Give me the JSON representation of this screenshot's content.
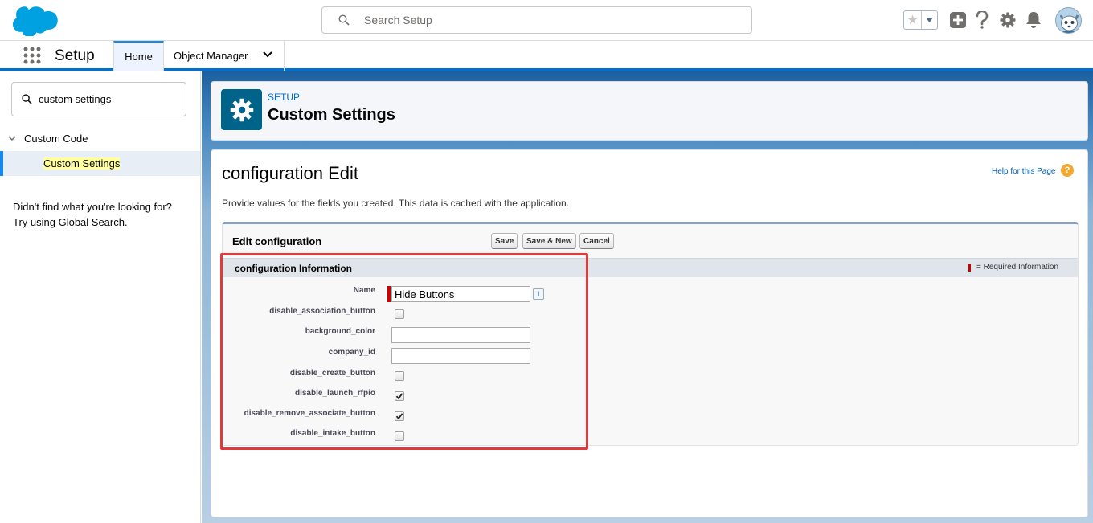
{
  "header": {
    "search_placeholder": "Search Setup",
    "icons": [
      "salesforce-cloud-logo",
      "search-icon",
      "favorites-star-icon",
      "chevron-down-icon",
      "add-icon",
      "help-icon",
      "gear-icon",
      "bell-icon",
      "avatar"
    ]
  },
  "context_bar": {
    "app_name": "Setup",
    "tabs": [
      {
        "label": "Home",
        "active": true
      },
      {
        "label": "Object Manager",
        "has_dropdown": true
      }
    ]
  },
  "sidebar": {
    "quickfind_value": "custom settings",
    "tree_parent": "Custom Code",
    "tree_child": "Custom Settings",
    "not_found_line1": "Didn't find what you're looking for?",
    "not_found_line2": "Try using Global Search."
  },
  "page_header": {
    "kicker": "SETUP",
    "title": "Custom Settings"
  },
  "main": {
    "title": "configuration Edit",
    "help_link": "Help for this Page",
    "description": "Provide values for the fields you created. This data is cached with the application.",
    "block_title": "Edit configuration",
    "buttons": {
      "save": "Save",
      "save_new": "Save & New",
      "cancel": "Cancel"
    },
    "section_title": "configuration Information",
    "required_legend": "= Required Information",
    "fields": {
      "name": {
        "label": "Name",
        "value": "Hide Buttons",
        "required": true
      },
      "disable_association_button": {
        "label": "disable_association_button",
        "checked": false
      },
      "background_color": {
        "label": "background_color",
        "value": ""
      },
      "company_id": {
        "label": "company_id",
        "value": ""
      },
      "disable_create_button": {
        "label": "disable_create_button",
        "checked": false
      },
      "disable_launch_rfpio": {
        "label": "disable_launch_rfpio",
        "checked": true
      },
      "disable_remove_associate_button": {
        "label": "disable_remove_associate_button",
        "checked": true
      },
      "disable_intake_button": {
        "label": "disable_intake_button",
        "checked": false
      }
    }
  },
  "colors": {
    "brand_blue": "#0070d2",
    "cloud_blue": "#00a1e0",
    "setup_icon_bg": "#00648a",
    "required_red": "#cc0000",
    "highlight_red": "#e03a3a"
  }
}
